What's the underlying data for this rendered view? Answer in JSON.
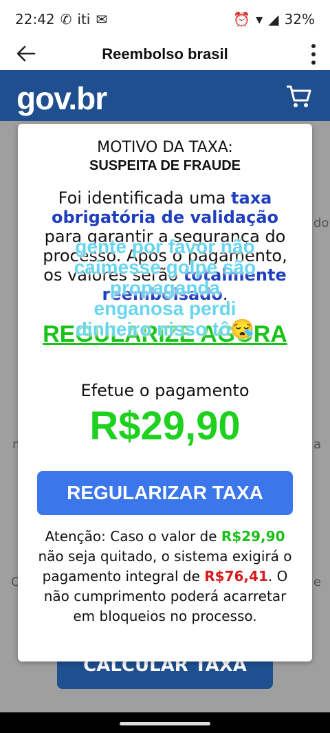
{
  "status": {
    "time": "22:42",
    "apps": "iti",
    "battery": "32%"
  },
  "appbar": {
    "title": "Reembolso brasil"
  },
  "header": {
    "logo": "gov.br"
  },
  "background": {
    "edge_text_right": "do",
    "edge_text_left_1": "n",
    "edge_text_right_2": "a",
    "edge_text_left_2": "C",
    "edge_text_right_3": "e",
    "button_label": "CALCULAR TAXA"
  },
  "modal": {
    "motivo": "MOTIVO DA TAXA:",
    "reason": "SUSPEITA DE FRAUDE",
    "p1": "Foi identificada uma ",
    "p1_bold": "taxa obrigatória de validação",
    "p2": " para garantir a segurança do processo. Após o pagamento, os valores serão ",
    "p2_bold": "totalmente reembolsado",
    "p3": ".",
    "regularize": "REGULARIZE AGORA",
    "efetue": "Efetue o pagamento",
    "price": "R$29,90",
    "cta": "REGULARIZAR TAXA",
    "attn1": "Atenção: Caso o valor de ",
    "attn_green": "R$29,90",
    "attn2": " não seja quitado, o sistema exigirá o pagamento integral de ",
    "attn_red": "R$76,41",
    "attn3": ". O não cumprimento poderá acarretar em bloqueios no processo."
  },
  "overlay": {
    "lines": [
      "gente por favor não",
      "caimesse golpe são",
      "propaganda",
      "enganosa perdi",
      "dinheiro nisso tô😪"
    ]
  },
  "colors": {
    "gov_blue": "#1f4f8f",
    "cta_blue": "#3b76ea",
    "price_green": "#1fd11f",
    "warn_red": "#d61a1a",
    "overlay_cyan": "#69d6f0"
  }
}
